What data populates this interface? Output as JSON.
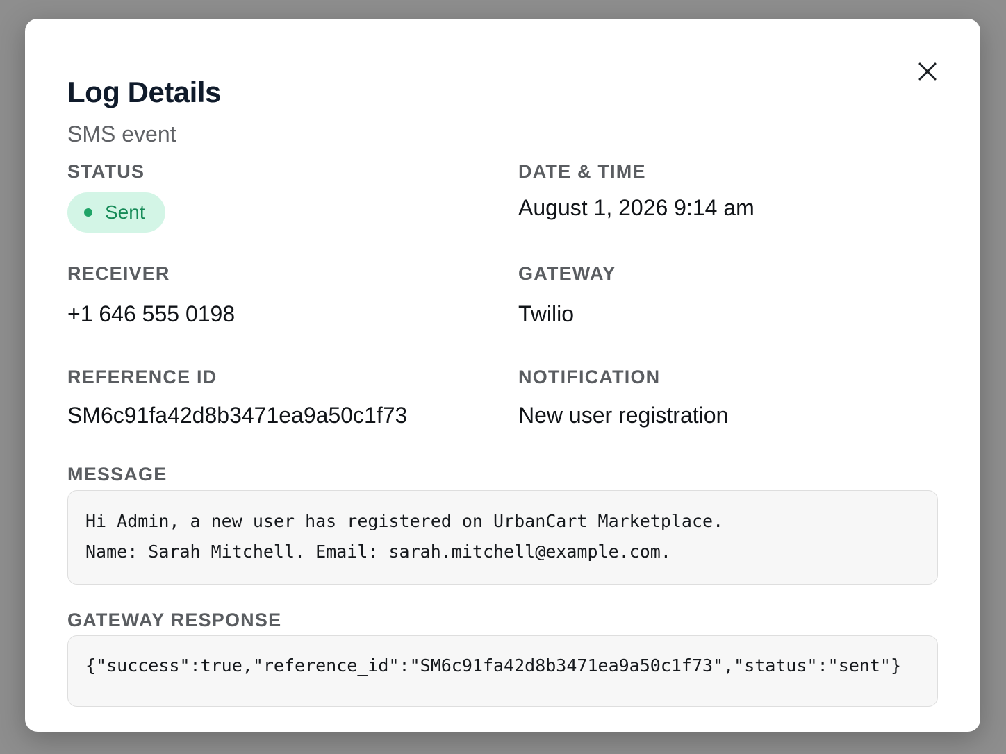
{
  "modal": {
    "title": "Log Details",
    "subtitle": "SMS event",
    "close_icon": "close-icon"
  },
  "fields": {
    "status": {
      "label": "STATUS",
      "value": "Sent",
      "color": "#1fa467"
    },
    "datetime": {
      "label": "DATE & TIME",
      "value": "August 1, 2026 9:14 am"
    },
    "receiver": {
      "label": "RECEIVER",
      "value": "+1 646 555 0198"
    },
    "gateway": {
      "label": "GATEWAY",
      "value": "Twilio"
    },
    "reference": {
      "label": "REFERENCE ID",
      "value": "SM6c91fa42d8b3471ea9a50c1f73"
    },
    "notification": {
      "label": "NOTIFICATION",
      "value": "New user registration"
    }
  },
  "message": {
    "label": "MESSAGE",
    "lines": [
      "Hi Admin, a new user has registered on UrbanCart Marketplace.",
      "Name: Sarah Mitchell. Email: sarah.mitchell@example.com."
    ]
  },
  "gateway_response": {
    "label": "GATEWAY RESPONSE",
    "value": "{\"success\":true,\"reference_id\":\"SM6c91fa42d8b3471ea9a50c1f73\",\"status\":\"sent\"}"
  }
}
